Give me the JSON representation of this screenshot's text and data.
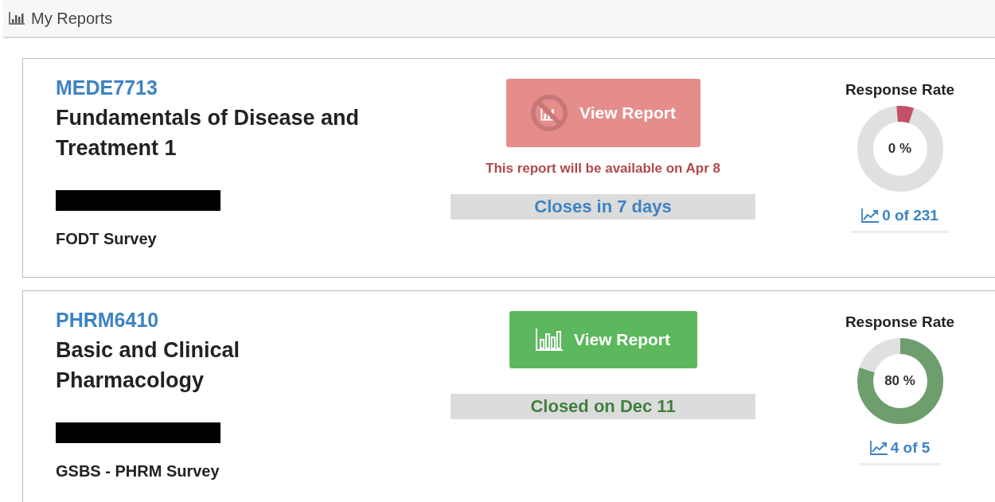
{
  "header": {
    "title": "My Reports"
  },
  "reports": [
    {
      "code": "MEDE7713",
      "name": "Fundamentals of Disease and Treatment 1",
      "redacted": true,
      "survey": "FODT Survey",
      "report_available": false,
      "button": "View Report",
      "availability_note": "This report will be available on Apr 8",
      "status": {
        "kind": "open",
        "text": "Closes in 7 days"
      },
      "rate_title": "Response Rate",
      "rate": {
        "level": 0,
        "text": "0 %"
      },
      "responses": "0 of 231"
    },
    {
      "code": "PHRM6410",
      "name": "Basic and Clinical Pharmacology",
      "redacted": true,
      "survey": "GSBS - PHRM Survey",
      "report_available": true,
      "button": "View Report",
      "status": {
        "kind": "closed",
        "text": "Closed on Dec 11"
      },
      "rate_title": "Response Rate",
      "rate": {
        "level": 0.8,
        "text": "80 %"
      },
      "responses": "4 of 5"
    }
  ]
}
